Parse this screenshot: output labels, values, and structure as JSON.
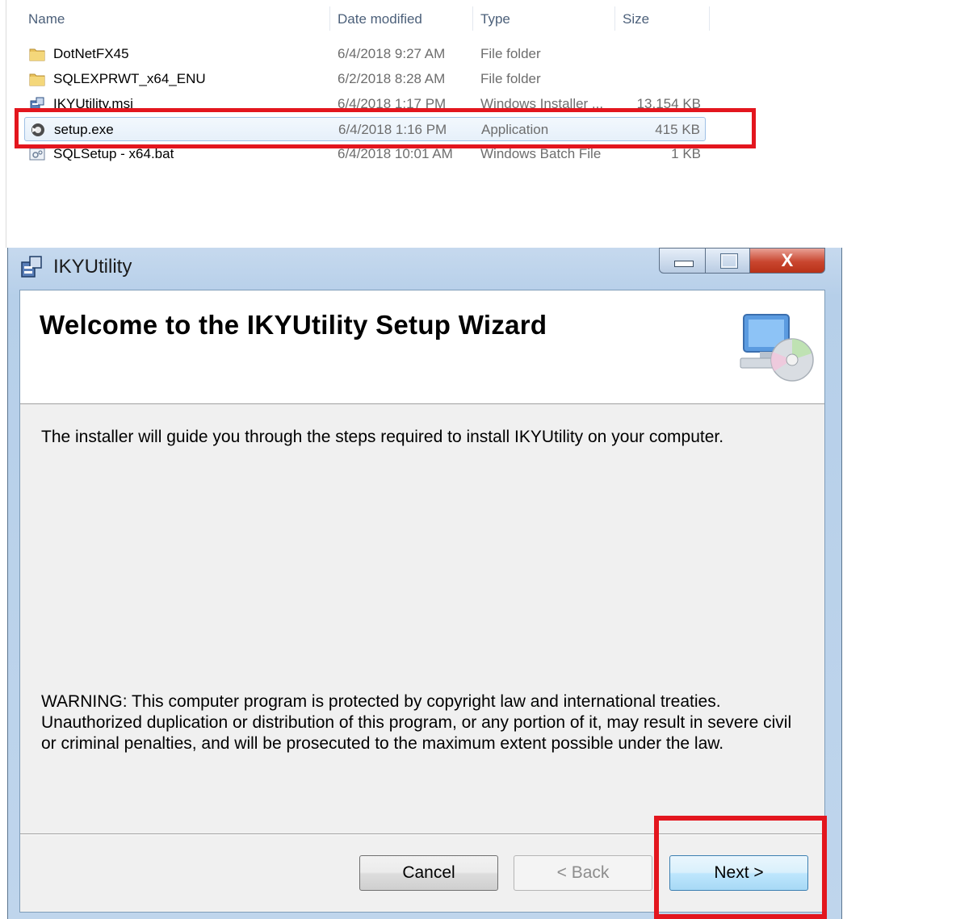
{
  "explorer": {
    "columns": {
      "name": "Name",
      "date": "Date modified",
      "type": "Type",
      "size": "Size"
    },
    "files": [
      {
        "name": "DotNetFX45",
        "date": "6/4/2018 9:27 AM",
        "type": "File folder",
        "size": "",
        "icon": "folder-icon"
      },
      {
        "name": "SQLEXPRWT_x64_ENU",
        "date": "6/2/2018 8:28 AM",
        "type": "File folder",
        "size": "",
        "icon": "folder-icon"
      },
      {
        "name": "IKYUtility.msi",
        "date": "6/4/2018 1:17 PM",
        "type": "Windows Installer ...",
        "size": "13,154 KB",
        "icon": "msi-package-icon"
      },
      {
        "name": "setup.exe",
        "date": "6/4/2018 1:16 PM",
        "type": "Application",
        "size": "415 KB",
        "icon": "setup-exe-icon"
      },
      {
        "name": "SQLSetup - x64.bat",
        "date": "6/4/2018 10:01 AM",
        "type": "Windows Batch File",
        "size": "1 KB",
        "icon": "batch-file-icon"
      }
    ]
  },
  "dialog": {
    "title": "IKYUtility",
    "heading": "Welcome to the IKYUtility Setup Wizard",
    "intro": "The installer will guide you through the steps required to install IKYUtility on your computer.",
    "warning": "WARNING: This computer program is protected by copyright law and international treaties. Unauthorized duplication or distribution of this program, or any portion of it, may result in severe civil or criminal penalties, and will be prosecuted to the maximum extent possible under the law.",
    "buttons": {
      "cancel": "Cancel",
      "back": "< Back",
      "next": "Next >"
    },
    "window_controls": {
      "close_glyph": "X"
    }
  },
  "colors": {
    "highlight": "#e3161e",
    "selection_border": "#9fc1e6"
  }
}
